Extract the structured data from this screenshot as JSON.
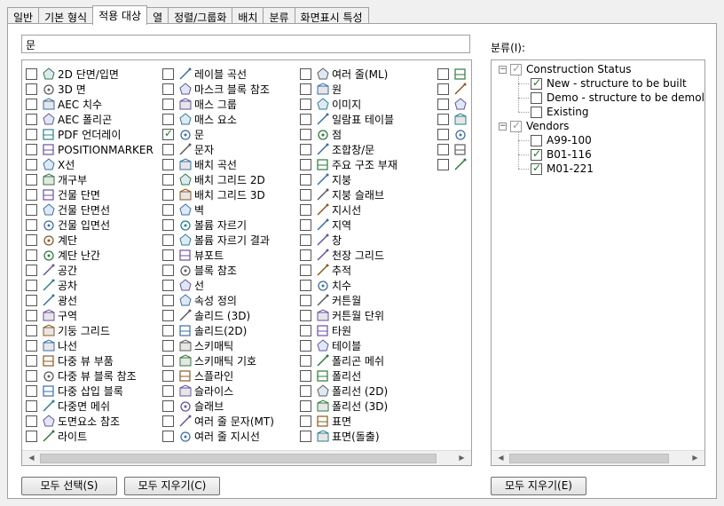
{
  "tabs": [
    "일반",
    "기본 형식",
    "적용 대상",
    "열",
    "정렬/그룹화",
    "배치",
    "분류",
    "화면표시 특성"
  ],
  "active_tab": "적용 대상",
  "search_value": "문",
  "columns": [
    [
      {
        "label": "2D 단면/입면",
        "icon": "section-2d-icon",
        "checked": false
      },
      {
        "label": "3D 면",
        "icon": "face-3d-icon",
        "checked": false
      },
      {
        "label": "AEC 치수",
        "icon": "aec-dimension-icon",
        "checked": false
      },
      {
        "label": "AEC 폴리곤",
        "icon": "aec-polygon-icon",
        "checked": false
      },
      {
        "label": "PDF 언더레이",
        "icon": "pdf-underlay-icon",
        "checked": false
      },
      {
        "label": "POSITIONMARKER",
        "icon": "position-marker-icon",
        "checked": false
      },
      {
        "label": "X선",
        "icon": "xline-icon",
        "checked": false
      },
      {
        "label": "개구부",
        "icon": "opening-icon",
        "checked": false
      },
      {
        "label": "건물 단면",
        "icon": "building-section-icon",
        "checked": false
      },
      {
        "label": "건물 단면선",
        "icon": "section-line-icon",
        "checked": false
      },
      {
        "label": "건물 입면선",
        "icon": "elevation-line-icon",
        "checked": false
      },
      {
        "label": "계단",
        "icon": "stair-icon",
        "checked": false
      },
      {
        "label": "계단 난간",
        "icon": "railing-icon",
        "checked": false
      },
      {
        "label": "공간",
        "icon": "space-icon",
        "checked": false
      },
      {
        "label": "공차",
        "icon": "tolerance-icon",
        "checked": false
      },
      {
        "label": "광선",
        "icon": "ray-icon",
        "checked": false
      },
      {
        "label": "구역",
        "icon": "zone-icon",
        "checked": false
      },
      {
        "label": "기둥 그리드",
        "icon": "column-grid-icon",
        "checked": false
      },
      {
        "label": "나선",
        "icon": "helix-icon",
        "checked": false
      },
      {
        "label": "다중 뷰 부품",
        "icon": "mv-part-icon",
        "checked": false
      },
      {
        "label": "다중 뷰 블록 참조",
        "icon": "mv-block-ref-icon",
        "checked": false
      },
      {
        "label": "다중 삽입 블록",
        "icon": "minsert-block-icon",
        "checked": false
      },
      {
        "label": "다중면 메쉬",
        "icon": "polyface-mesh-icon",
        "checked": false
      },
      {
        "label": "도면요소 참조",
        "icon": "element-ref-icon",
        "checked": false
      },
      {
        "label": "라이트",
        "icon": "light-icon",
        "checked": false
      }
    ],
    [
      {
        "label": "레이블 곡선",
        "icon": "label-curve-icon",
        "checked": false
      },
      {
        "label": "마스크 블록 참조",
        "icon": "mask-block-icon",
        "checked": false
      },
      {
        "label": "매스 그룹",
        "icon": "mass-group-icon",
        "checked": false
      },
      {
        "label": "매스 요소",
        "icon": "mass-element-icon",
        "checked": false
      },
      {
        "label": "문",
        "icon": "door-icon",
        "checked": true
      },
      {
        "label": "문자",
        "icon": "text-icon",
        "checked": false
      },
      {
        "label": "배치 곡선",
        "icon": "layout-curve-icon",
        "checked": false
      },
      {
        "label": "배치 그리드 2D",
        "icon": "layout-grid-2d-icon",
        "checked": false
      },
      {
        "label": "배치 그리드 3D",
        "icon": "layout-grid-3d-icon",
        "checked": false
      },
      {
        "label": "벽",
        "icon": "wall-icon",
        "checked": false
      },
      {
        "label": "볼륨 자르기",
        "icon": "volume-clip-icon",
        "checked": false
      },
      {
        "label": "볼륨 자르기 결과",
        "icon": "volume-clip-result-icon",
        "checked": false
      },
      {
        "label": "뷰포트",
        "icon": "viewport-icon",
        "checked": false
      },
      {
        "label": "블록 참조",
        "icon": "block-ref-icon",
        "checked": false
      },
      {
        "label": "선",
        "icon": "line-icon",
        "checked": false
      },
      {
        "label": "속성 정의",
        "icon": "attribute-def-icon",
        "checked": false
      },
      {
        "label": "솔리드 (3D)",
        "icon": "solid-3d-icon",
        "checked": false
      },
      {
        "label": "솔리드(2D)",
        "icon": "solid-2d-icon",
        "checked": false
      },
      {
        "label": "스키매틱",
        "icon": "schematic-icon",
        "checked": false
      },
      {
        "label": "스키매틱 기호",
        "icon": "schematic-symbol-icon",
        "checked": false
      },
      {
        "label": "스플라인",
        "icon": "spline-icon",
        "checked": false
      },
      {
        "label": "슬라이스",
        "icon": "slice-icon",
        "checked": false
      },
      {
        "label": "슬래브",
        "icon": "slab-icon",
        "checked": false
      },
      {
        "label": "여러 줄 문자(MT)",
        "icon": "mtext-icon",
        "checked": false
      },
      {
        "label": "여러 줄 지시선",
        "icon": "mleader-icon",
        "checked": false
      }
    ],
    [
      {
        "label": "여러 줄(ML)",
        "icon": "mline-icon",
        "checked": false
      },
      {
        "label": "원",
        "icon": "circle-icon",
        "checked": false
      },
      {
        "label": "이미지",
        "icon": "image-icon",
        "checked": false
      },
      {
        "label": "일람표 테이블",
        "icon": "schedule-table-icon",
        "checked": false
      },
      {
        "label": "점",
        "icon": "point-icon",
        "checked": false
      },
      {
        "label": "조합창/문",
        "icon": "door-window-assembly-icon",
        "checked": false
      },
      {
        "label": "주요 구조 부재",
        "icon": "structural-member-icon",
        "checked": false
      },
      {
        "label": "지붕",
        "icon": "roof-icon",
        "checked": false
      },
      {
        "label": "지붕 슬래브",
        "icon": "roof-slab-icon",
        "checked": false
      },
      {
        "label": "지시선",
        "icon": "leader-icon",
        "checked": false
      },
      {
        "label": "지역",
        "icon": "region-icon",
        "checked": false
      },
      {
        "label": "창",
        "icon": "window-icon",
        "checked": false
      },
      {
        "label": "천장 그리드",
        "icon": "ceiling-grid-icon",
        "checked": false
      },
      {
        "label": "추적",
        "icon": "trace-icon",
        "checked": false
      },
      {
        "label": "치수",
        "icon": "dimension-icon",
        "checked": false
      },
      {
        "label": "커튼월",
        "icon": "curtain-wall-icon",
        "checked": false
      },
      {
        "label": "커튼월 단위",
        "icon": "curtain-wall-unit-icon",
        "checked": false
      },
      {
        "label": "타원",
        "icon": "ellipse-icon",
        "checked": false
      },
      {
        "label": "테이블",
        "icon": "table-icon",
        "checked": false
      },
      {
        "label": "폴리곤 메쉬",
        "icon": "polygon-mesh-icon",
        "checked": false
      },
      {
        "label": "폴리선",
        "icon": "polyline-icon",
        "checked": false
      },
      {
        "label": "폴리선 (2D)",
        "icon": "polyline-2d-icon",
        "checked": false
      },
      {
        "label": "폴리선 (3D)",
        "icon": "polyline-3d-icon",
        "checked": false
      },
      {
        "label": "표면",
        "icon": "surface-icon",
        "checked": false
      },
      {
        "label": "표면(돌출)",
        "icon": "surface-extrusion-icon",
        "checked": false
      }
    ],
    [
      {
        "label": "",
        "icon": "cut-off-icon-1",
        "checked": false
      },
      {
        "label": "",
        "icon": "cut-off-icon-2",
        "checked": false
      },
      {
        "label": "",
        "icon": "cut-off-icon-3",
        "checked": false
      },
      {
        "label": "",
        "icon": "cut-off-icon-4",
        "checked": false
      },
      {
        "label": "",
        "icon": "cut-off-icon-5",
        "checked": false
      },
      {
        "label": "",
        "icon": "cut-off-icon-6",
        "checked": false
      },
      {
        "label": "",
        "icon": "cut-off-icon-7",
        "checked": false
      }
    ]
  ],
  "buttons": {
    "select_all": "모두 선택(S)",
    "clear_all": "모두 지우기(C)",
    "clear_all_categories": "모두 지우기(E)"
  },
  "category_label": "분류(I):",
  "categories": [
    {
      "label": "Construction Status",
      "checked": true,
      "children": [
        {
          "label": "New - structure to be built",
          "checked": true
        },
        {
          "label": "Demo - structure to be demolished",
          "checked": false
        },
        {
          "label": "Existing",
          "checked": false
        }
      ]
    },
    {
      "label": "Vendors",
      "checked": true,
      "children": [
        {
          "label": "A99-100",
          "checked": false
        },
        {
          "label": "B01-116",
          "checked": true
        },
        {
          "label": "M01-221",
          "checked": true
        }
      ]
    }
  ]
}
